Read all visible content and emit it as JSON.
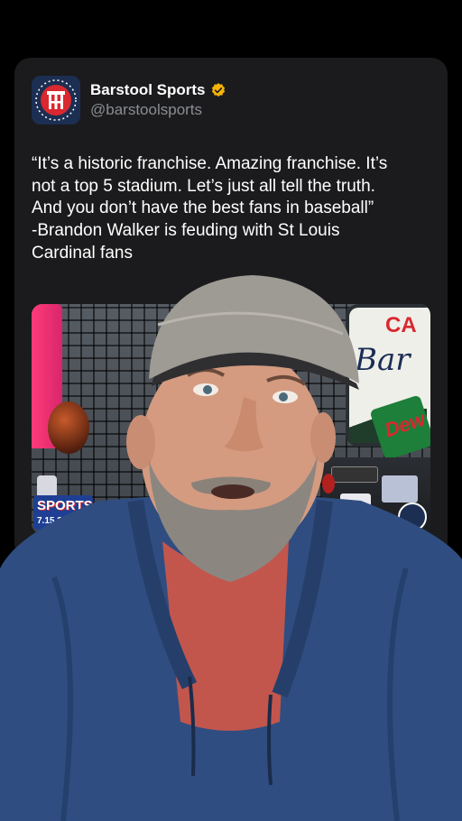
{
  "tweet": {
    "display_name": "Barstool Sports",
    "handle": "@barstoolsports",
    "verified_color": "#f5b30a",
    "text_lines": [
      "“It’s a historic franchise. Amazing franchise. It’s",
      "not a top 5 stadium. Let’s just all tell the truth.",
      "And you don’t have the best fans in baseball”",
      "-Brandon Walker is feuding with St Louis",
      "Cardinal fans"
    ]
  },
  "media": {
    "logo_line1": "SPORTS",
    "logo_date": "7.15.26",
    "sign_text_top": "CA",
    "sign_text_script": "Bar",
    "can_text": "Dew"
  },
  "colors": {
    "background": "#000000",
    "card": "#1b1b1d",
    "secondary_text": "#8a8d91",
    "hoodie": "#2f4d80",
    "shirt": "#c2564d"
  }
}
